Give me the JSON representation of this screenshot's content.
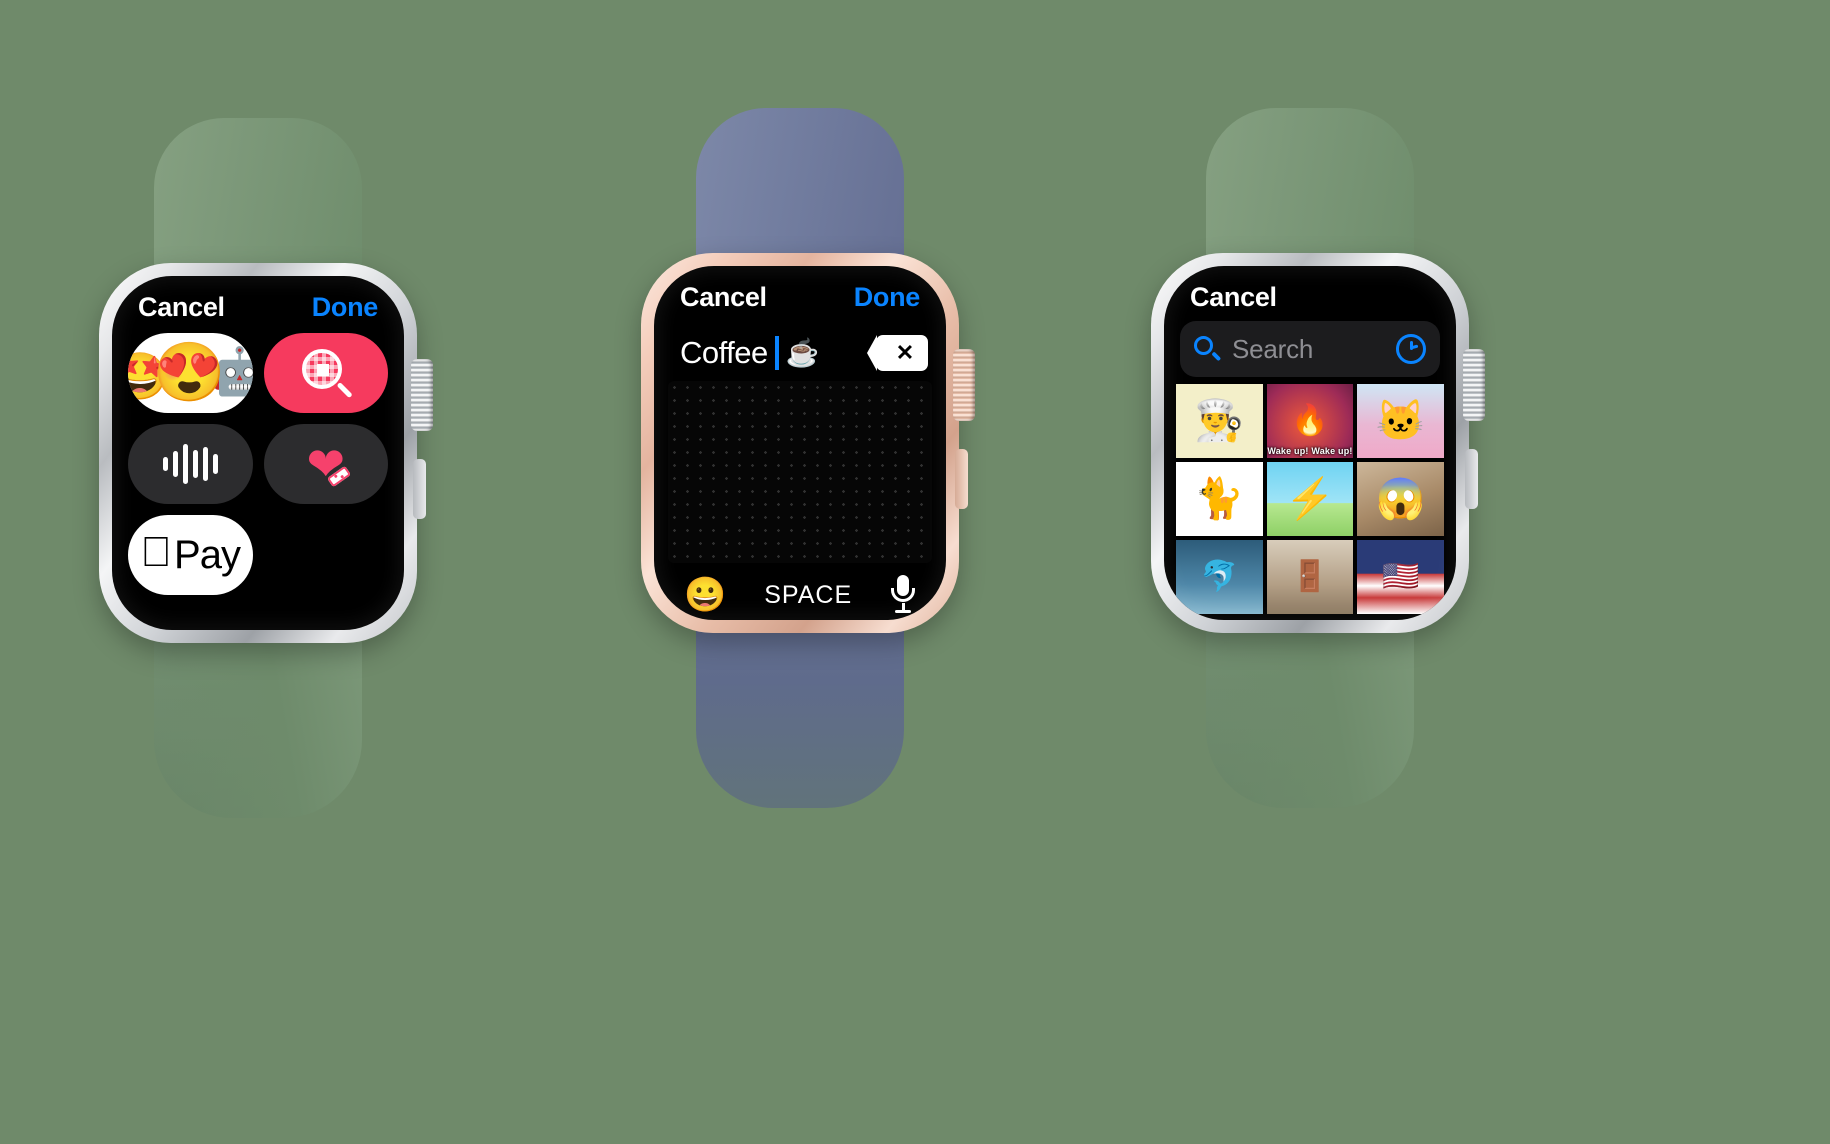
{
  "scene": {
    "background_color": "#6f8a6a",
    "watch_count": 3
  },
  "watches": [
    {
      "id": "watch-attachments",
      "case_finish": "silver-aluminum",
      "band_color": "#7b977a",
      "band_name": "pine-green-sport-band",
      "screen": {
        "name": "message-attachment-picker",
        "navbar": {
          "cancel": "Cancel",
          "done": "Done"
        },
        "tiles": [
          {
            "name": "memoji-sticker",
            "icon": "memoji-faces-icon",
            "bg": "#ffffff",
            "emojis": [
              "🤩",
              "😍",
              "🤖"
            ]
          },
          {
            "name": "gif-search",
            "icon": "gif-magnifier-icon",
            "bg": "#f63a5e",
            "label": ""
          },
          {
            "name": "audio-message",
            "icon": "waveform-icon",
            "bg": "#2c2c2e",
            "label": ""
          },
          {
            "name": "digital-touch-heartbeat",
            "icon": "heartbeat-icon",
            "bg": "#2c2c2e",
            "label": ""
          },
          {
            "name": "apple-pay",
            "icon": "apple-pay-logo",
            "bg": "#ffffff",
            "logo_glyph": "",
            "text": "Pay"
          }
        ],
        "waveform_bars": [
          14,
          26,
          40,
          28,
          34,
          20
        ]
      }
    },
    {
      "id": "watch-keyboard",
      "case_finish": "gold-aluminum",
      "band_color": "#6d7899",
      "band_name": "linen-blue-sport-band",
      "screen": {
        "name": "scribble-keyboard",
        "navbar": {
          "cancel": "Cancel",
          "done": "Done"
        },
        "input": {
          "name": "message-compose-field",
          "value": "Coffee",
          "trailing_emoji": "☕",
          "caret_color": "#0a84ff",
          "delete_key_label": "✕"
        },
        "scribble_area_label": "scribble-input-pad",
        "bottom_bar": {
          "emoji_key": "😀",
          "space_label": "SPACE",
          "dictation_icon": "microphone-icon"
        }
      }
    },
    {
      "id": "watch-gif-search",
      "case_finish": "silver-aluminum",
      "band_color": "#7b977a",
      "band_name": "pine-green-sport-band",
      "screen": {
        "name": "gif-browser",
        "navbar": {
          "cancel": "Cancel"
        },
        "search": {
          "name": "gif-search-field",
          "placeholder": "Search",
          "value": "",
          "leading_icon": "search-magnifier-icon",
          "trailing_icon": "recents-clock-icon",
          "accent_color": "#0a84ff"
        },
        "results": [
          {
            "name": "gif-felix-chef",
            "caption": "",
            "bg_class": "bg-cartoon-cream",
            "emoji": "👨‍🍳"
          },
          {
            "name": "gif-wake-up",
            "caption": "Wake up! Wake up!",
            "bg_class": "bg-redglow",
            "emoji": "🔥"
          },
          {
            "name": "gif-sylvester-tweety",
            "caption": "",
            "bg_class": "bg-sylvester",
            "emoji": "🐱"
          },
          {
            "name": "gif-garfield-wave",
            "caption": "",
            "bg_class": "bg-white",
            "emoji": "🐈"
          },
          {
            "name": "gif-pikachu-eevee",
            "caption": "",
            "bg_class": "bg-pokemon",
            "emoji": "⚡"
          },
          {
            "name": "gif-person-reaction",
            "caption": "",
            "bg_class": "bg-person",
            "emoji": "😱"
          },
          {
            "name": "gif-water-splash",
            "caption": "",
            "bg_class": "bg-water",
            "emoji": "🐬"
          },
          {
            "name": "gif-room-scene",
            "caption": "",
            "bg_class": "bg-room",
            "emoji": "🚪"
          },
          {
            "name": "gif-flag",
            "caption": "",
            "bg_class": "bg-flag",
            "emoji": "🇺🇸"
          }
        ]
      }
    }
  ]
}
